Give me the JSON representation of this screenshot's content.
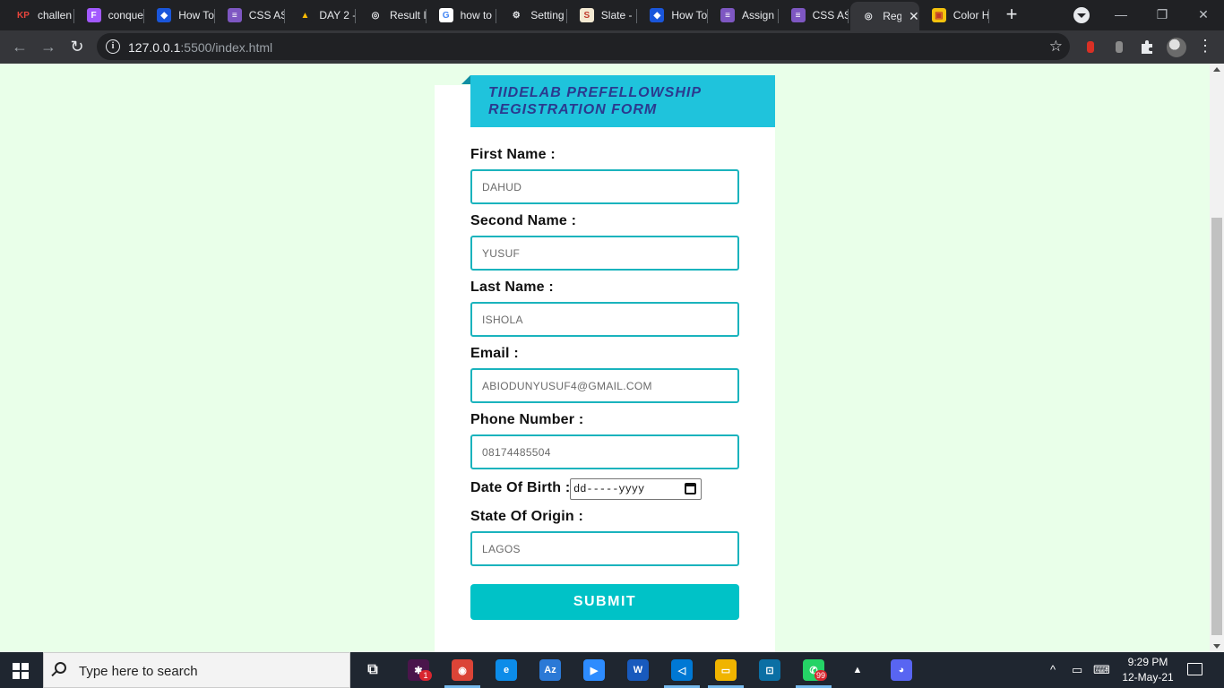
{
  "browser": {
    "tabs": [
      {
        "favicon": "kp-logo-icon",
        "fav_text": "KP",
        "fav_bg": "#202124",
        "fav_color": "#e8453c",
        "title": "challen"
      },
      {
        "favicon": "figma-icon",
        "fav_text": "F",
        "fav_bg": "#a259ff",
        "fav_color": "#ffffff",
        "title": "conque"
      },
      {
        "favicon": "diamond-icon",
        "fav_text": "◆",
        "fav_bg": "#1a56db",
        "fav_color": "#ffffff",
        "title": "How To"
      },
      {
        "favicon": "list-icon",
        "fav_text": "≡",
        "fav_bg": "#7e57c2",
        "fav_color": "#ffffff",
        "title": "CSS AS"
      },
      {
        "favicon": "google-drive-icon",
        "fav_text": "▲",
        "fav_bg": "#202124",
        "fav_color": "#fbbc04",
        "title": "DAY 2 -"
      },
      {
        "favicon": "globe-icon",
        "fav_text": "◎",
        "fav_bg": "#202124",
        "fav_color": "#e8eaed",
        "title": "Result I"
      },
      {
        "favicon": "google-icon",
        "fav_text": "G",
        "fav_bg": "#ffffff",
        "fav_color": "#4285f4",
        "title": "how to"
      },
      {
        "favicon": "gear-icon",
        "fav_text": "⚙",
        "fav_bg": "#202124",
        "fav_color": "#e8eaed",
        "title": "Setting"
      },
      {
        "favicon": "slate-icon",
        "fav_text": "S",
        "fav_bg": "#f3e9d2",
        "fav_color": "#c0392b",
        "title": "Slate - "
      },
      {
        "favicon": "diamond-icon",
        "fav_text": "◆",
        "fav_bg": "#1a56db",
        "fav_color": "#ffffff",
        "title": "How To"
      },
      {
        "favicon": "list-icon",
        "fav_text": "≡",
        "fav_bg": "#7e57c2",
        "fav_color": "#ffffff",
        "title": "Assign"
      },
      {
        "favicon": "list-icon",
        "fav_text": "≡",
        "fav_bg": "#7e57c2",
        "fav_color": "#ffffff",
        "title": "CSS AS"
      },
      {
        "favicon": "globe-icon",
        "fav_text": "◎",
        "fav_bg": "#35363a",
        "fav_color": "#e8eaed",
        "title": "Reg",
        "active": true
      },
      {
        "favicon": "color-picker-icon",
        "fav_text": "▣",
        "fav_bg": "#f4c20d",
        "fav_color": "#c0392b",
        "title": "Color H"
      }
    ],
    "new_tab": "+",
    "close_tab": "✕",
    "url_host": "127.0.0.1",
    "url_rest": ":5500/index.html",
    "minimize": "—",
    "maximize": "❐",
    "close": "✕"
  },
  "form": {
    "title_line1": "TIIDELAB PREFELLOWSHIP",
    "title_line2": "REGISTRATION FORM",
    "first_name_label": "First Name :",
    "first_name_value": "DAHUD",
    "second_name_label": "Second Name :",
    "second_name_value": "YUSUF",
    "last_name_label": "Last Name :",
    "last_name_value": "ISHOLA",
    "email_label": "Email :",
    "email_value": "ABIODUNYUSUF4@GMAIL.COM",
    "phone_label": "Phone Number :",
    "phone_value": "08174485504",
    "dob_label": "Date Of Birth :",
    "dob_placeholder": "dd-----yyyy",
    "state_label": "State Of Origin :",
    "state_value": "LAGOS",
    "submit_label": "SUBMIT"
  },
  "colors": {
    "page_bg": "#e9ffe9",
    "banner_bg": "#1fc3dc",
    "banner_text": "#2b3a8f",
    "field_border": "#1ab3bd",
    "submit_bg": "#00c2c7"
  },
  "taskbar": {
    "search_placeholder": "Type here to search",
    "apps": [
      {
        "name": "slack-icon",
        "text": "✱",
        "bg": "#4a154b",
        "badge": "1"
      },
      {
        "name": "chrome-icon",
        "text": "◉",
        "bg": "#db4437"
      },
      {
        "name": "edge-icon",
        "text": "e",
        "bg": "#0c8ce9"
      },
      {
        "name": "azure-data-studio-icon",
        "text": "Az",
        "bg": "#2b79d6"
      },
      {
        "name": "zoom-icon",
        "text": "▶",
        "bg": "#2d8cff"
      },
      {
        "name": "word-icon",
        "text": "W",
        "bg": "#185abd"
      },
      {
        "name": "vscode-icon",
        "text": "◁",
        "bg": "#0078d4"
      },
      {
        "name": "file-explorer-icon",
        "text": "▭",
        "bg": "#f0b400"
      },
      {
        "name": "remote-desktop-icon",
        "text": "⊡",
        "bg": "#0b6fa4"
      },
      {
        "name": "whatsapp-icon",
        "text": "✆",
        "bg": "#25d366",
        "badge": "99"
      },
      {
        "name": "google-drive-icon",
        "text": "▲",
        "bg": "#1f2630"
      },
      {
        "name": "discord-icon",
        "text": "◕",
        "bg": "#5865f2"
      }
    ],
    "time": "9:29 PM",
    "date": "12-May-21"
  }
}
